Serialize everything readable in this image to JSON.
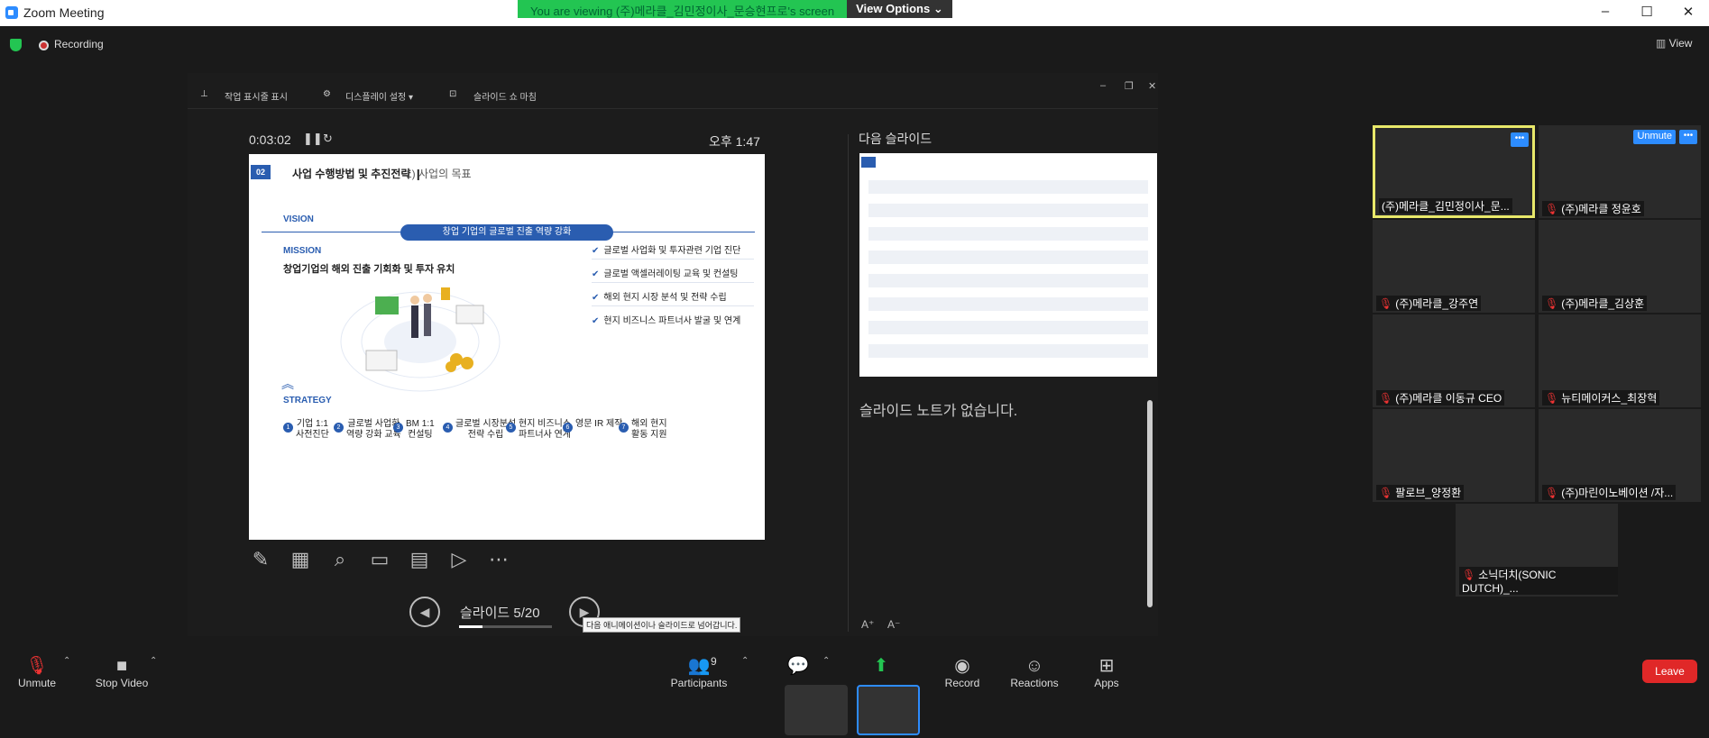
{
  "window": {
    "title": "Zoom Meeting"
  },
  "banner": {
    "message": "You are viewing (주)메라클_김민정이사_문승현프로's screen",
    "options": "View Options ⌄"
  },
  "status": {
    "recording": "Recording",
    "view": "View"
  },
  "presenter": {
    "buttons": {
      "show_taskbar": "작업 표시줄 표시",
      "display_settings": "디스플레이 설정 ▾",
      "end_show": "슬라이드 쇼 마침"
    },
    "timer": "0:03:02",
    "clock": "오후 1:47",
    "slide_counter": "슬라이드 5/20",
    "tooltip": "다음 애니메이션이나 슬라이드로 넘어갑니다.",
    "next_slide_label": "다음 슬라이드",
    "notes": "슬라이드 노트가 없습니다.",
    "progress": 0.25
  },
  "slide": {
    "number": "02",
    "title": "사업 수행방법 및 추진전략 ❙",
    "subtitle": "1) 사업의 목표",
    "vision_label": "VISION",
    "vision_pill": "창업 기업의 글로벌 진출 역량 강화",
    "mission_label": "MISSION",
    "mission_text": "창업기업의 해외 진출 기회화 및 투자 유치",
    "checks": [
      "글로벌 사업화 및 투자관련 기업 진단",
      "글로벌 액셀러레이팅 교육 및 컨설팅",
      "해외 현지 시장 분석 및 전략 수립",
      "현지 비즈니스 파트너사 발굴 및 연계"
    ],
    "strategy_label": "STRATEGY",
    "strategies": [
      {
        "n": "1",
        "text": "기업 1:1\n사전진단"
      },
      {
        "n": "2",
        "text": "글로벌 사업화\n역량 강화 교육"
      },
      {
        "n": "3",
        "text": "BM 1:1\n컨설팅"
      },
      {
        "n": "4",
        "text": "글로벌 시장분석\n전략 수립"
      },
      {
        "n": "5",
        "text": "현지 비즈니스\n파트너사 연계"
      },
      {
        "n": "6",
        "text": "영문 IR 제작"
      },
      {
        "n": "7",
        "text": "해외 현지\n활동 지원"
      }
    ]
  },
  "participants": [
    {
      "name": "(주)메라클_김민정이사_문...",
      "muted": false
    },
    {
      "name": "(주)메라클 정윤호",
      "muted": true
    },
    {
      "name": "(주)메라클_강주연",
      "muted": true
    },
    {
      "name": "(주)메라클_김상훈",
      "muted": true
    },
    {
      "name": "(주)메라클 이동규 CEO",
      "muted": true
    },
    {
      "name": "뉴티메이커스_최장혁",
      "muted": true
    },
    {
      "name": "팔로브_양정환",
      "muted": true
    },
    {
      "name": "(주)마린이노베이션 /자...",
      "muted": true
    },
    {
      "name": "소닉더치(SONIC DUTCH)_...",
      "muted": true
    }
  ],
  "tile_buttons": {
    "unmute": "Unmute",
    "more": "•••"
  },
  "toolbar": {
    "unmute": "Unmute",
    "stop_video": "Stop Video",
    "participants": "Participants",
    "participant_count": "9",
    "record": "Record",
    "reactions": "Reactions",
    "apps": "Apps",
    "leave": "Leave"
  }
}
